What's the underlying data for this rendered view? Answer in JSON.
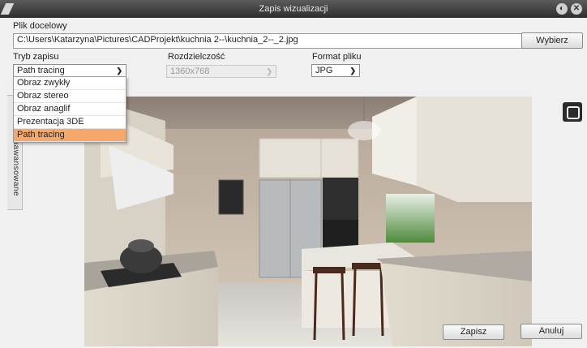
{
  "window": {
    "title": "Zapis wizualizacji"
  },
  "target_file": {
    "label": "Plik docelowy",
    "value": "C:\\Users\\Katarzyna\\Pictures\\CADProjekt\\kuchnia 2--\\kuchnia_2--_2.jpg",
    "browse_label": "Wybierz"
  },
  "mode": {
    "label": "Tryb zapisu",
    "selected": "Path tracing",
    "options": [
      "Obraz zwykły",
      "Obraz stereo",
      "Obraz anaglif",
      "Prezentacja 3DE",
      "Path tracing"
    ]
  },
  "resolution": {
    "label": "Rozdzielczość",
    "selected": "1360x768"
  },
  "format": {
    "label": "Format pliku",
    "selected": "JPG"
  },
  "side_tab": {
    "label": "Zaawansowane"
  },
  "actions": {
    "save_label": "Zapisz",
    "cancel_label": "Anuluj"
  },
  "icons": {
    "minimize": "circle-minimize-icon",
    "close": "circle-close-icon",
    "fullscreen": "fullscreen-icon"
  },
  "colors": {
    "selected_option": "#f5a86a",
    "titlebar": "#3a3a3a"
  }
}
